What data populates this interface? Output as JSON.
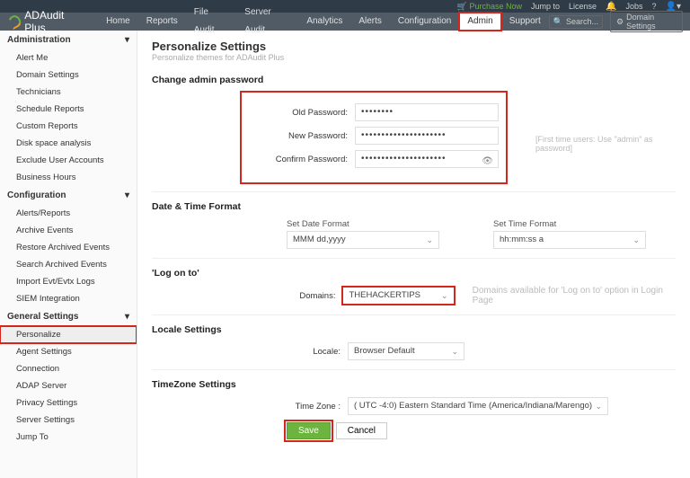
{
  "topbar": {
    "purchase": "Purchase Now",
    "jumpto": "Jump to",
    "license": "License",
    "jobs": "Jobs",
    "help": "?"
  },
  "logo": "ADAudit Plus",
  "nav": {
    "items": [
      "Home",
      "Reports",
      "File Audit",
      "Server Audit",
      "Analytics",
      "Alerts",
      "Configuration",
      "Admin",
      "Support"
    ],
    "search_ph": "Search...",
    "domain_settings": "Domain Settings"
  },
  "sidebar": {
    "s1": {
      "title": "Administration",
      "items": [
        "Alert Me",
        "Domain Settings",
        "Technicians",
        "Schedule Reports",
        "Custom Reports",
        "Disk space analysis",
        "Exclude User Accounts",
        "Business Hours"
      ]
    },
    "s2": {
      "title": "Configuration",
      "items": [
        "Alerts/Reports",
        "Archive Events",
        "Restore Archived Events",
        "Search Archived Events",
        "Import Evt/Evtx Logs",
        "SIEM Integration"
      ]
    },
    "s3": {
      "title": "General Settings",
      "items": [
        "Personalize",
        "Agent Settings",
        "Connection",
        "ADAP Server",
        "Privacy Settings",
        "Server Settings",
        "Jump To"
      ]
    }
  },
  "page": {
    "title": "Personalize Settings",
    "subtitle": "Personalize themes for ADAudit Plus"
  },
  "pw": {
    "section": "Change admin password",
    "old_lbl": "Old Password:",
    "new_lbl": "New Password:",
    "conf_lbl": "Confirm Password:",
    "old": "••••••••",
    "new": "•••••••••••••••••••••",
    "conf": "•••••••••••••••••••••",
    "hint": "[First time users: Use \"admin\" as password]"
  },
  "dt": {
    "section": "Date & Time Format",
    "date_lbl": "Set Date Format",
    "date_val": "MMM dd,yyyy",
    "time_lbl": "Set Time Format",
    "time_val": "hh:mm:ss a"
  },
  "logon": {
    "section": "'Log on to'",
    "lbl": "Domains:",
    "val": "THEHACKERTIPS",
    "hint": "Domains available for 'Log on to' option in Login Page"
  },
  "locale": {
    "section": "Locale Settings",
    "lbl": "Locale:",
    "val": "Browser Default"
  },
  "tz": {
    "section": "TimeZone Settings",
    "lbl": "Time Zone :",
    "val": "( UTC -4:0) Eastern Standard Time (America/Indiana/Marengo)"
  },
  "btn": {
    "save": "Save",
    "cancel": "Cancel"
  }
}
